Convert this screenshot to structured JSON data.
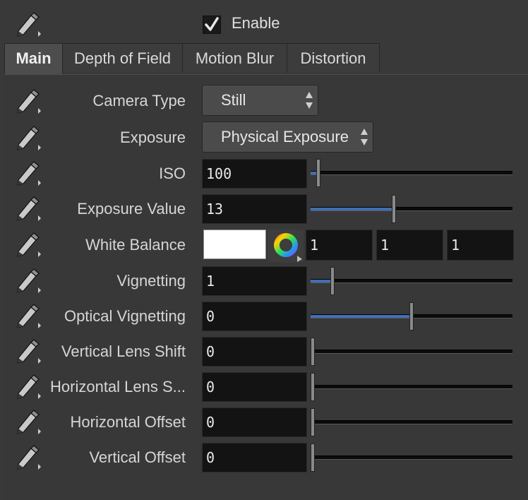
{
  "header": {
    "enable_label": "Enable",
    "enable_checked": true
  },
  "tabs": [
    "Main",
    "Depth of Field",
    "Motion Blur",
    "Distortion"
  ],
  "active_tab": "Main",
  "params": {
    "camera_type": {
      "label": "Camera Type",
      "value": "Still"
    },
    "exposure": {
      "label": "Exposure",
      "value": "Physical Exposure"
    },
    "iso": {
      "label": "ISO",
      "value": "100",
      "slider_fraction": 0.03
    },
    "exposure_value": {
      "label": "Exposure Value",
      "value": "13",
      "slider_fraction": 0.41
    },
    "white_balance": {
      "label": "White Balance",
      "swatch_color": "#ffffff",
      "r": "1",
      "g": "1",
      "b": "1"
    },
    "vignetting": {
      "label": "Vignetting",
      "value": "1",
      "slider_fraction": 0.1
    },
    "optical_vignetting": {
      "label": "Optical Vignetting",
      "value": "0",
      "slider_fraction": 0.5
    },
    "vertical_lens_shift": {
      "label": "Vertical Lens Shift",
      "value": "0",
      "slider_fraction": 0.0
    },
    "horizontal_lens_shift": {
      "label": "Horizontal Lens S...",
      "value": "0",
      "slider_fraction": 0.0
    },
    "horizontal_offset": {
      "label": "Horizontal Offset",
      "value": "0",
      "slider_fraction": 0.0
    },
    "vertical_offset": {
      "label": "Vertical Offset",
      "value": "0",
      "slider_fraction": 0.0
    }
  },
  "icons": {
    "row_action": "pencil-icon",
    "check": "checkmark-icon",
    "color_wheel": "color-wheel-icon",
    "dropdown_arrows": "updown-arrows-icon"
  },
  "colors": {
    "slider_fill": "#3f6fb5",
    "background": "#393939",
    "field": "#131313"
  }
}
